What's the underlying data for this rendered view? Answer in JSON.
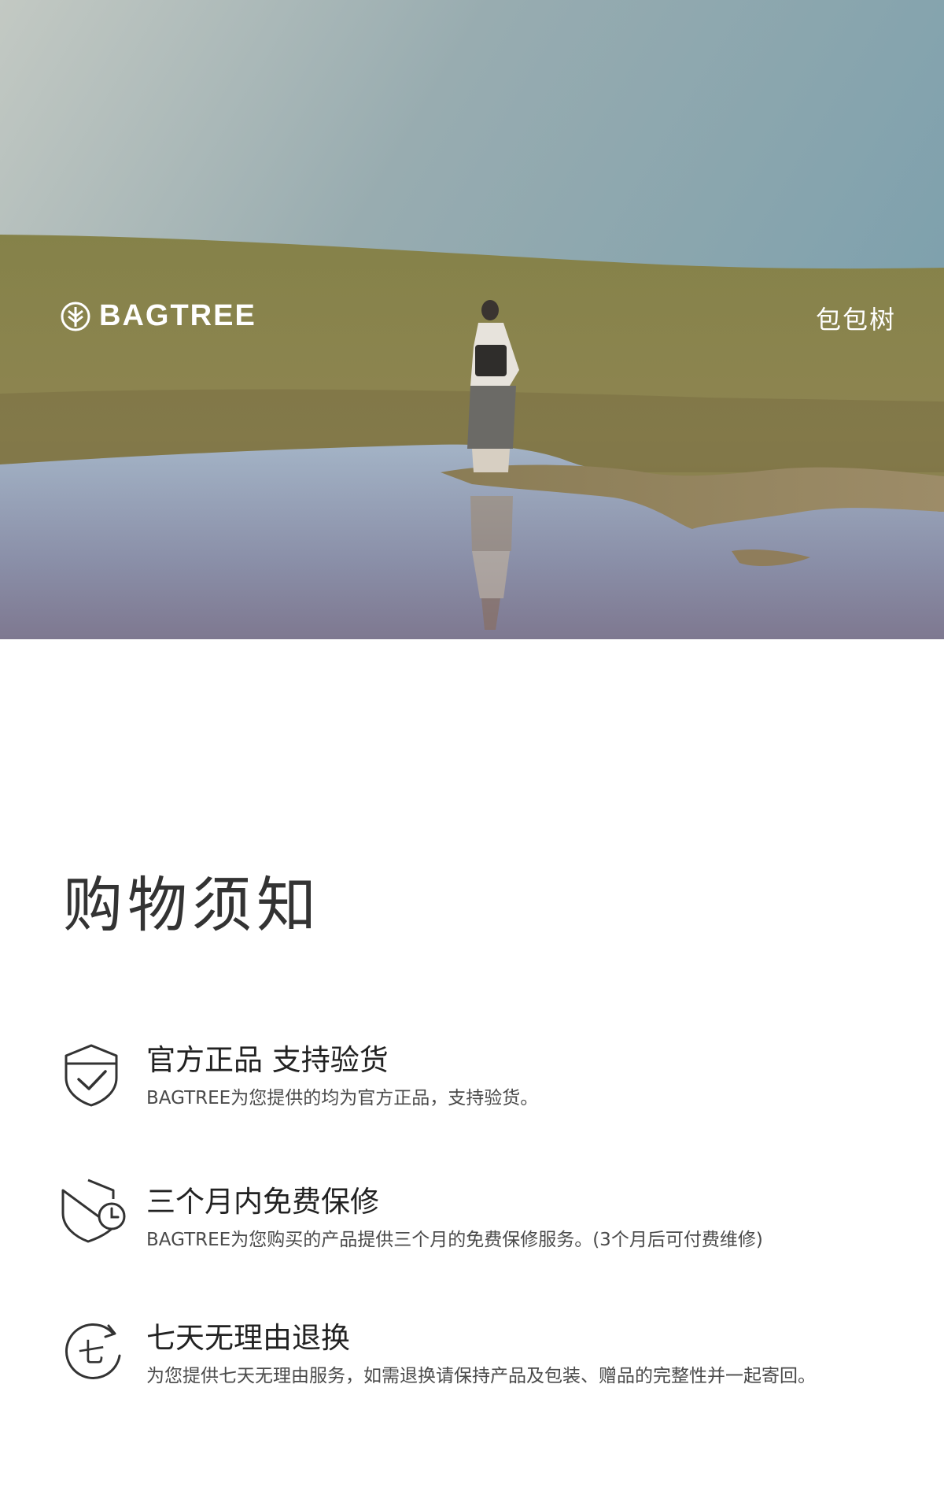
{
  "hero": {
    "brand_name": "BAGTREE",
    "brand_name_cn": "包包树"
  },
  "notice": {
    "title": "购物须知",
    "items": [
      {
        "icon": "shield-check-icon",
        "title": "官方正品 支持验货",
        "desc": "BAGTREE为您提供的均为官方正品，支持验货。"
      },
      {
        "icon": "shield-clock-icon",
        "title": "三个月内免费保修",
        "desc": "BAGTREE为您购买的产品提供三个月的免费保修服务。(3个月后可付费维修)"
      },
      {
        "icon": "seven-day-return-icon",
        "icon_glyph": "七",
        "title": "七天无理由退换",
        "desc": "为您提供七天无理由服务，如需退换请保持产品及包装、赠品的完整性并一起寄回。"
      }
    ]
  },
  "colors": {
    "sky_top": "#9fb0b4",
    "grass": "#8c8550",
    "water": "#8d99b0",
    "text_dark": "#2a2a2a"
  }
}
